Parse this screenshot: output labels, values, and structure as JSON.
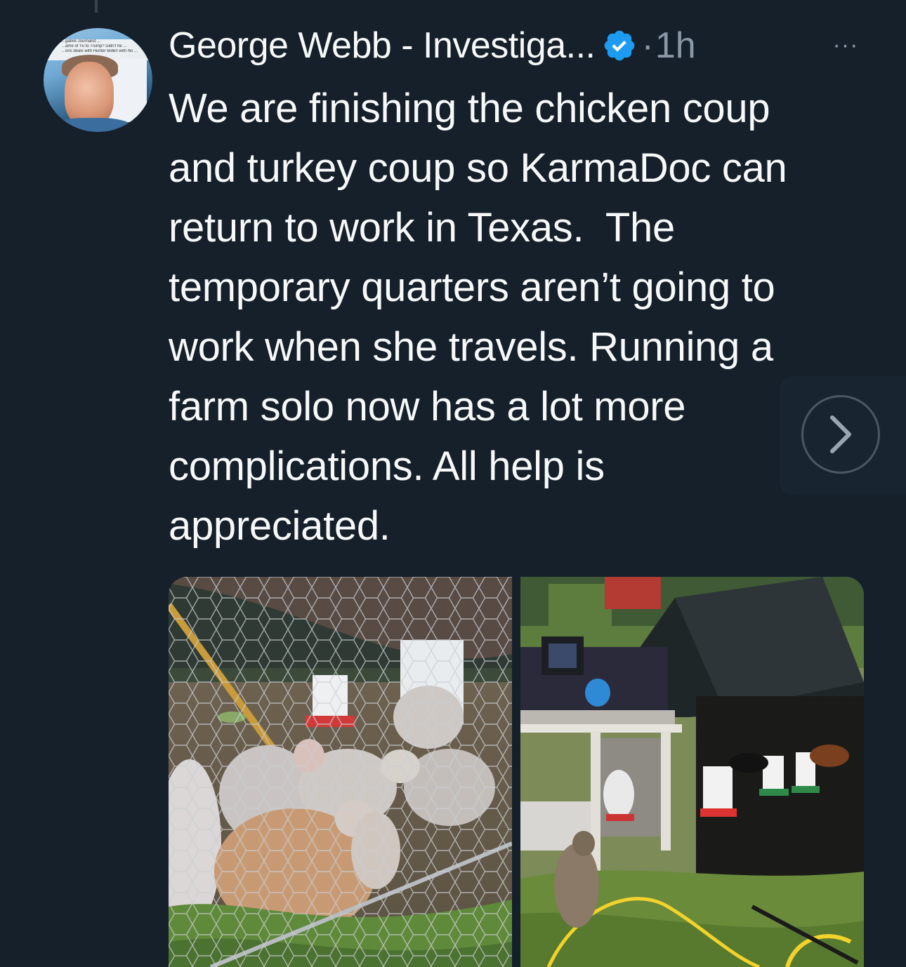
{
  "tweet": {
    "author_name": "George Webb - Investiga...",
    "separator": "·",
    "timestamp": "1h",
    "more_label": "···",
    "text": "We are finishing the chicken coup\nand turkey coup so KarmaDoc can\nreturn to work in Texas.  The\ntemporary quarters aren’t going to\nwork when she travels. Running a\nfarm solo now has a lot more\ncomplications. All help is\nappreciated.",
    "avatar_banner_lines": [
      "...gative Journalist ...",
      "...ame of Yu to Trump? Didn't he ...",
      "...ons deals with Hunter Biden with his ..."
    ]
  },
  "media": {
    "photos": [
      {
        "subject": "turkey-poults-behind-chicken-wire"
      },
      {
        "subject": "chicken-coop-with-tarp-and-cat"
      }
    ]
  },
  "icons": {
    "verified": "verified-badge-icon",
    "more": "more-options-icon",
    "next": "chevron-right-icon"
  },
  "colors": {
    "background": "#15202b",
    "text_primary": "#f7f9f9",
    "text_secondary": "#8b98a5",
    "verified_blue": "#1d9bf0"
  }
}
